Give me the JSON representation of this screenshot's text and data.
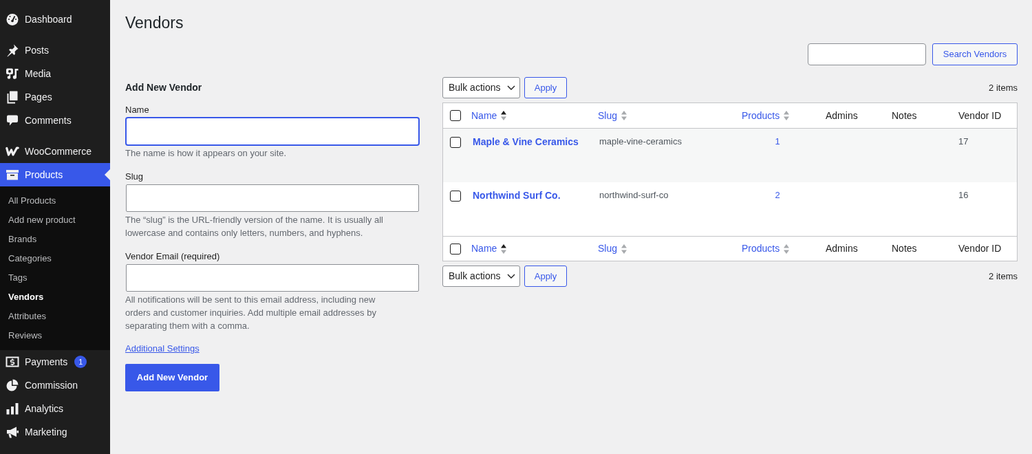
{
  "sidebar": {
    "groups": [
      {
        "items": [
          {
            "label": "Dashboard",
            "selected": false
          }
        ]
      },
      {
        "items": [
          {
            "label": "Posts",
            "selected": false
          },
          {
            "label": "Media",
            "selected": false
          },
          {
            "label": "Pages",
            "selected": false
          },
          {
            "label": "Comments",
            "selected": false
          }
        ]
      },
      {
        "items": [
          {
            "label": "WooCommerce",
            "selected": false
          },
          {
            "label": "Products",
            "selected": true,
            "children": [
              {
                "label": "All Products",
                "selected": false
              },
              {
                "label": "Add new product",
                "selected": false
              },
              {
                "label": "Brands",
                "selected": false
              },
              {
                "label": "Categories",
                "selected": false
              },
              {
                "label": "Tags",
                "selected": false
              },
              {
                "label": "Vendors",
                "selected": true
              },
              {
                "label": "Attributes",
                "selected": false
              },
              {
                "label": "Reviews",
                "selected": false
              }
            ]
          },
          {
            "label": "Payments",
            "selected": false,
            "badge": "1"
          },
          {
            "label": "Commission",
            "selected": false
          },
          {
            "label": "Analytics",
            "selected": false
          },
          {
            "label": "Marketing",
            "selected": false
          }
        ]
      }
    ]
  },
  "page_title": "Vendors",
  "search": {
    "button": "Search Vendors"
  },
  "form": {
    "title": "Add New Vendor",
    "fields": [
      {
        "label": "Name",
        "focused": true,
        "hint": "The name is how it appears on your site."
      },
      {
        "label": "Slug",
        "focused": false,
        "hint": "The “slug” is the URL-friendly version of the name. It is usually all lowercase and contains only letters, numbers, and hyphens."
      },
      {
        "label": "Vendor Email (required)",
        "focused": false,
        "hint": "All notifications will be sent to this email address, including new orders and customer inquiries. Add multiple email addresses by separating them with a comma."
      }
    ],
    "link": "Additional Settings",
    "submit": "Add New Vendor"
  },
  "top_nav": {
    "bulk_action": "Bulk actions",
    "apply": "Apply",
    "count": "2 items"
  },
  "table": {
    "header": {
      "checked": false,
      "columns": [
        {
          "label": "Name",
          "sortable": true,
          "sorted": true
        },
        {
          "label": "Slug",
          "sortable": true,
          "sorted": false
        },
        {
          "label": "Products",
          "sortable": true,
          "sorted": false
        },
        {
          "label": "Admins",
          "sortable": false
        },
        {
          "label": "Notes",
          "sortable": false
        },
        {
          "label": "Vendor ID",
          "sortable": false
        }
      ]
    },
    "rows": [
      {
        "checked": false,
        "name": "Maple & Vine Ceramics",
        "slug": "maple-vine-ceramics",
        "products": "1",
        "vendor_id": "17"
      },
      {
        "checked": false,
        "name": "Northwind Surf Co.",
        "slug": "northwind-surf-co",
        "products": "2",
        "vendor_id": "16"
      }
    ],
    "footer": {
      "checked": false,
      "columns": [
        {
          "label": "Name",
          "sortable": true,
          "sorted": true
        },
        {
          "label": "Slug",
          "sortable": true,
          "sorted": false
        },
        {
          "label": "Products",
          "sortable": true,
          "sorted": false
        },
        {
          "label": "Admins",
          "sortable": false
        },
        {
          "label": "Notes",
          "sortable": false
        },
        {
          "label": "Vendor ID",
          "sortable": false
        }
      ]
    }
  },
  "bottom_nav": {
    "bulk_action": "Bulk actions",
    "apply": "Apply",
    "count": "2 items"
  }
}
